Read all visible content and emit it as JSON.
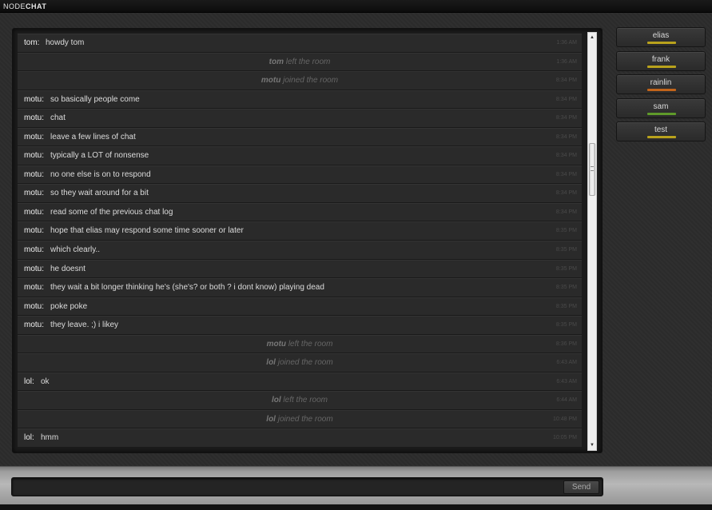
{
  "app": {
    "logo_light": "NODE",
    "logo_bold": "CHAT"
  },
  "messages": [
    {
      "type": "msg",
      "nick": "tom:",
      "text": "howdy tom",
      "time": "1:36 AM"
    },
    {
      "type": "event",
      "who": "tom",
      "action": "left the room",
      "time": "1:36 AM"
    },
    {
      "type": "event",
      "who": "motu",
      "action": "joined the room",
      "time": "8:34 PM"
    },
    {
      "type": "msg",
      "nick": "motu:",
      "text": "so basically people come",
      "time": "8:34 PM"
    },
    {
      "type": "msg",
      "nick": "motu:",
      "text": "chat",
      "time": "8:34 PM"
    },
    {
      "type": "msg",
      "nick": "motu:",
      "text": "leave a few lines of chat",
      "time": "8:34 PM"
    },
    {
      "type": "msg",
      "nick": "motu:",
      "text": "typically a LOT of nonsense",
      "time": "8:34 PM"
    },
    {
      "type": "msg",
      "nick": "motu:",
      "text": "no one else is on to respond",
      "time": "8:34 PM"
    },
    {
      "type": "msg",
      "nick": "motu:",
      "text": "so they wait around for a bit",
      "time": "8:34 PM"
    },
    {
      "type": "msg",
      "nick": "motu:",
      "text": "read some of the previous chat log",
      "time": "8:34 PM"
    },
    {
      "type": "msg",
      "nick": "motu:",
      "text": "hope that elias may respond some time sooner or later",
      "time": "8:35 PM"
    },
    {
      "type": "msg",
      "nick": "motu:",
      "text": "which clearly..",
      "time": "8:35 PM"
    },
    {
      "type": "msg",
      "nick": "motu:",
      "text": "he doesnt",
      "time": "8:35 PM"
    },
    {
      "type": "msg",
      "nick": "motu:",
      "text": "they wait a bit longer thinking he's (she's? or both ? i dont know) playing dead",
      "time": "8:35 PM"
    },
    {
      "type": "msg",
      "nick": "motu:",
      "text": "poke poke",
      "time": "8:35 PM"
    },
    {
      "type": "msg",
      "nick": "motu:",
      "text": "they leave. ;) i likey",
      "time": "8:35 PM"
    },
    {
      "type": "event",
      "who": "motu",
      "action": "left the room",
      "time": "8:36 PM"
    },
    {
      "type": "event",
      "who": "lol",
      "action": "joined the room",
      "time": "6:43 AM"
    },
    {
      "type": "msg",
      "nick": "lol:",
      "text": "ok",
      "time": "6:43 AM"
    },
    {
      "type": "event",
      "who": "lol",
      "action": "left the room",
      "time": "6:44 AM"
    },
    {
      "type": "event",
      "who": "lol",
      "action": "joined the room",
      "time": "10:48 PM"
    },
    {
      "type": "msg",
      "nick": "lol:",
      "text": "hmm",
      "time": "10:05 PM"
    }
  ],
  "users": [
    {
      "name": "elias",
      "status_color": "#b9a21c"
    },
    {
      "name": "frank",
      "status_color": "#b9a21c"
    },
    {
      "name": "rainlin",
      "status_color": "#c2641a"
    },
    {
      "name": "sam",
      "status_color": "#5f9a2a"
    },
    {
      "name": "test",
      "status_color": "#b9a21c"
    }
  ],
  "composer": {
    "input_value": "",
    "send_label": "Send"
  }
}
